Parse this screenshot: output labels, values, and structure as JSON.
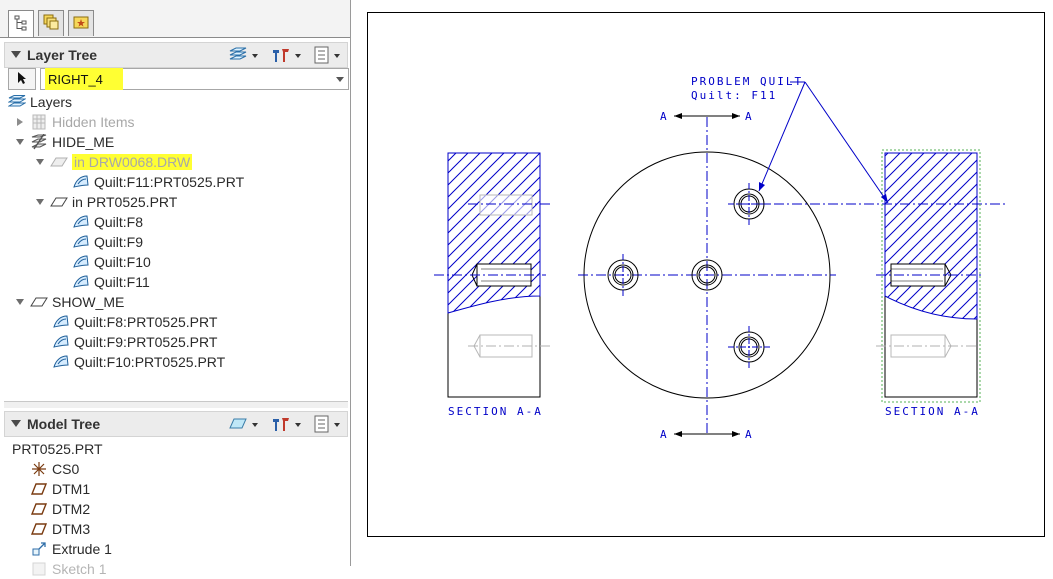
{
  "navigator": {
    "tabs": [
      {
        "icon": "model-tree-tab-icon",
        "active": true
      },
      {
        "icon": "folder-browser-tab-icon",
        "active": false
      },
      {
        "icon": "favorites-tab-icon",
        "active": false
      }
    ]
  },
  "layer_tree": {
    "title": "Layer Tree",
    "filter_value": "RIGHT_4",
    "rows": {
      "layers": "Layers",
      "hidden_items": "Hidden Items",
      "hide_me": "HIDE_ME",
      "in_drw": "in DRW0068.DRW",
      "quilt_f11_prt": "Quilt:F11:PRT0525.PRT",
      "in_prt": "in PRT0525.PRT",
      "quilt_f8": "Quilt:F8",
      "quilt_f9": "Quilt:F9",
      "quilt_f10": "Quilt:F10",
      "quilt_f11": "Quilt:F11",
      "show_me": "SHOW_ME",
      "quilt_f8_prt": "Quilt:F8:PRT0525.PRT",
      "quilt_f9_prt": "Quilt:F9:PRT0525.PRT",
      "quilt_f10_prt": "Quilt:F10:PRT0525.PRT"
    }
  },
  "model_tree": {
    "title": "Model Tree",
    "root": "PRT0525.PRT",
    "items": [
      "CS0",
      "DTM1",
      "DTM2",
      "DTM3",
      "Extrude 1",
      "Sketch 1"
    ]
  },
  "drawing": {
    "note_line1": "PROBLEM QUILT",
    "note_line2": "Quilt: F11",
    "section_label_left": "SECTION  A-A",
    "section_label_right": "SECTION  A-A",
    "cut_letter": "A",
    "colors": {
      "annotation": "#0000c8",
      "geometry": "#000000",
      "highlight": "#ffff33",
      "quilt_edge": "#2fa02f"
    }
  }
}
